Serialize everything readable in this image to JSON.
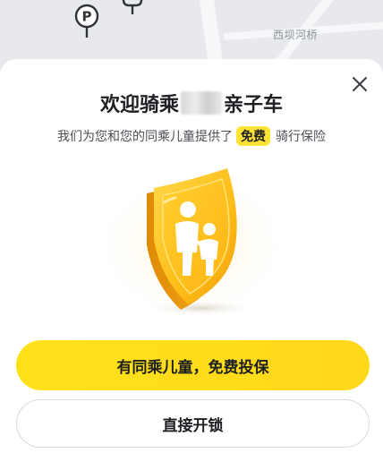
{
  "map": {
    "place_label": "西坝河桥",
    "parking_letter": "P"
  },
  "dialog": {
    "title_prefix": "欢迎骑乘",
    "title_suffix": "亲子车",
    "subtitle_prefix": "我们为您和您的同乘儿童提供了",
    "subtitle_badge": "免费",
    "subtitle_suffix": "骑行保险",
    "primary_button": "有同乘儿童，免费投保",
    "secondary_button": "直接开锁"
  },
  "colors": {
    "accent_yellow": "#ffe11a",
    "shield_gold": "#ffc21f",
    "text_dark": "#1d1f23"
  },
  "icons": {
    "close": "close-icon",
    "parking": "parking-pin-icon",
    "shield": "child-shield-icon"
  }
}
